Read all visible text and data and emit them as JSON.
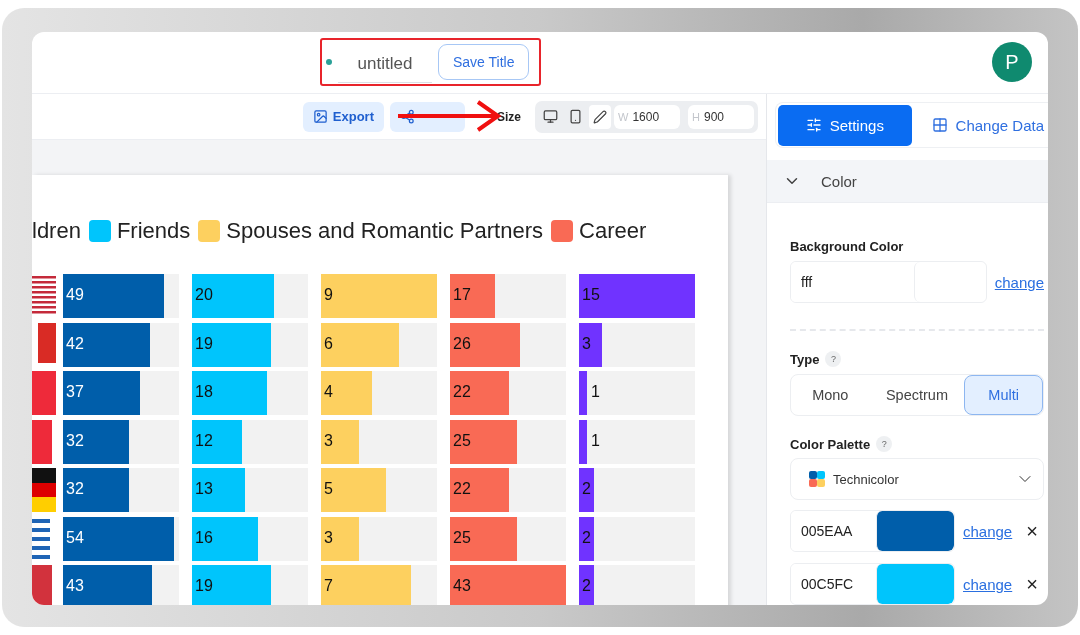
{
  "header": {
    "title_field": {
      "value": "untitled"
    },
    "save_button": "Save Title",
    "avatar": "P"
  },
  "toolbar": {
    "export_button": "Export",
    "size_label": "Size",
    "size_options": [
      {
        "kind": "desktop",
        "selected": false
      },
      {
        "kind": "mobile",
        "selected": false
      },
      {
        "kind": "custom",
        "selected": true
      }
    ],
    "width_field": {
      "prefix": "W",
      "value": "1600"
    },
    "height_field": {
      "prefix": "H",
      "value": "900"
    }
  },
  "chart": {
    "legend": [
      {
        "label": "ldren"
      },
      {
        "label": "Friends",
        "color": "#00c5fc"
      },
      {
        "label": "Spouses and Romantic Partners",
        "color": "#fdd05f"
      },
      {
        "label": "Career",
        "color": "#f96a55"
      }
    ],
    "columns": [
      {
        "color": "#005eaa"
      },
      {
        "color": "#00c5fc"
      },
      {
        "color": "#fdd05f"
      },
      {
        "color": "#f96a55"
      },
      {
        "color": "#7033ff"
      }
    ],
    "rows": [
      {
        "cells": [
          {
            "value": "49",
            "level": 0.87
          },
          {
            "value": "20",
            "level": 0.71
          },
          {
            "value": "9",
            "level": 1
          },
          {
            "value": "17",
            "level": 0.39
          },
          {
            "value": "15",
            "level": 1
          }
        ]
      },
      {
        "cells": [
          {
            "value": "42",
            "level": 0.75
          },
          {
            "value": "19",
            "level": 0.68
          },
          {
            "value": "6",
            "level": 0.67
          },
          {
            "value": "26",
            "level": 0.6
          },
          {
            "value": "3",
            "level": 0.2
          }
        ]
      },
      {
        "cells": [
          {
            "value": "37",
            "level": 0.66
          },
          {
            "value": "18",
            "level": 0.65
          },
          {
            "value": "4",
            "level": 0.44
          },
          {
            "value": "22",
            "level": 0.51
          },
          {
            "value": "1",
            "level": 0.07
          }
        ]
      },
      {
        "cells": [
          {
            "value": "32",
            "level": 0.57
          },
          {
            "value": "12",
            "level": 0.43
          },
          {
            "value": "3",
            "level": 0.33
          },
          {
            "value": "25",
            "level": 0.58
          },
          {
            "value": "1",
            "level": 0.07
          }
        ]
      },
      {
        "cells": [
          {
            "value": "32",
            "level": 0.57
          },
          {
            "value": "13",
            "level": 0.46
          },
          {
            "value": "5",
            "level": 0.56
          },
          {
            "value": "22",
            "level": 0.51
          },
          {
            "value": "2",
            "level": 0.13
          }
        ]
      },
      {
        "cells": [
          {
            "value": "54",
            "level": 0.96
          },
          {
            "value": "16",
            "level": 0.57
          },
          {
            "value": "3",
            "level": 0.33
          },
          {
            "value": "25",
            "level": 0.58
          },
          {
            "value": "2",
            "level": 0.13
          }
        ]
      },
      {
        "cells": [
          {
            "value": "43",
            "level": 0.77
          },
          {
            "value": "19",
            "level": 0.68
          },
          {
            "value": "7",
            "level": 0.78
          },
          {
            "value": "43",
            "level": 1
          },
          {
            "value": "2",
            "level": 0.13
          }
        ]
      }
    ]
  },
  "sidebar": {
    "tabs": [
      {
        "label": "Settings",
        "selected": true
      },
      {
        "label": "Change Data",
        "selected": false
      }
    ],
    "section": {
      "title": "Color",
      "expanded": true
    },
    "background": {
      "label": "Background Color",
      "value": "fff",
      "color": "#ffffff",
      "link": "change"
    },
    "type": {
      "label": "Type",
      "help": "?",
      "options": [
        {
          "label": "Mono",
          "selected": false
        },
        {
          "label": "Spectrum",
          "selected": false
        },
        {
          "label": "Multi",
          "selected": true
        }
      ]
    },
    "palette": {
      "label": "Color Palette",
      "help": "?",
      "value": "Technicolor"
    },
    "colors": [
      {
        "hex": "005EAA",
        "color": "#005eaa",
        "link": "change",
        "remove": "×"
      },
      {
        "hex": "00C5FC",
        "color": "#00c5fc",
        "link": "change",
        "remove": "×"
      }
    ]
  }
}
